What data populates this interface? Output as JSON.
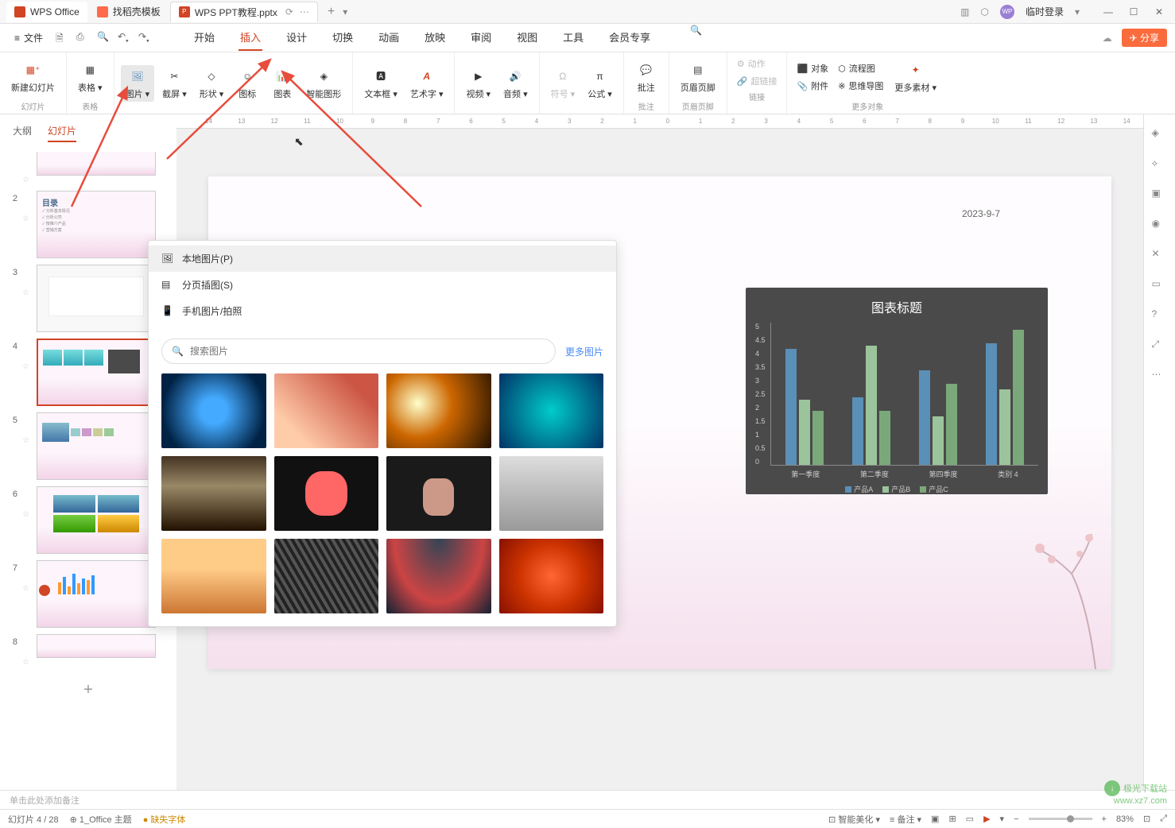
{
  "titlebar": {
    "wps_tab": "WPS Office",
    "template_tab": "找稻壳模板",
    "active_tab": "WPS PPT教程.pptx",
    "add_tab": "+",
    "login": "临时登录"
  },
  "menubar": {
    "file": "文件",
    "tabs": [
      "开始",
      "插入",
      "设计",
      "切换",
      "动画",
      "放映",
      "审阅",
      "视图",
      "工具",
      "会员专享"
    ],
    "active_tab_index": 1,
    "share": "分享"
  },
  "ribbon": {
    "groups": [
      {
        "label": "幻灯片",
        "buttons": [
          {
            "label": "新建幻灯片"
          }
        ]
      },
      {
        "label": "表格",
        "buttons": [
          {
            "label": "表格"
          }
        ]
      },
      {
        "label": "",
        "buttons": [
          {
            "label": "图片",
            "highlighted": true
          },
          {
            "label": "截屏"
          },
          {
            "label": "形状"
          },
          {
            "label": "图标"
          },
          {
            "label": "图表"
          },
          {
            "label": "智能图形"
          }
        ]
      },
      {
        "label": "",
        "buttons": [
          {
            "label": "文本框"
          },
          {
            "label": "艺术字"
          }
        ]
      },
      {
        "label": "",
        "buttons": [
          {
            "label": "视频"
          },
          {
            "label": "音频"
          }
        ]
      },
      {
        "label": "",
        "buttons": [
          {
            "label": "符号"
          },
          {
            "label": "公式"
          }
        ]
      },
      {
        "label": "批注",
        "buttons": [
          {
            "label": "批注"
          }
        ]
      },
      {
        "label": "页眉页脚",
        "buttons": [
          {
            "label": "页眉页脚"
          }
        ]
      },
      {
        "label": "链接",
        "small": [
          {
            "label": "动作",
            "disabled": true
          },
          {
            "label": "超链接",
            "disabled": true
          }
        ]
      },
      {
        "label": "更多对象",
        "buttons": [
          {
            "label": "对象"
          },
          {
            "label": "附件"
          }
        ],
        "small": [
          {
            "label": "流程图"
          },
          {
            "label": "思维导图"
          },
          {
            "label": "更多素材"
          }
        ]
      }
    ]
  },
  "left_panel": {
    "tabs": [
      "大纲",
      "幻灯片"
    ],
    "active_tab_index": 1,
    "slides": [
      {
        "num": ""
      },
      {
        "num": "2",
        "title": "目录"
      },
      {
        "num": "3"
      },
      {
        "num": "4",
        "selected": true
      },
      {
        "num": "5"
      },
      {
        "num": "6"
      },
      {
        "num": "7"
      },
      {
        "num": "8"
      }
    ]
  },
  "image_panel": {
    "items": [
      {
        "label": "本地图片(P)",
        "hover": true
      },
      {
        "label": "分页插图(S)"
      },
      {
        "label": "手机图片/拍照"
      }
    ],
    "search_placeholder": "搜索图片",
    "more": "更多图片",
    "thumbs": [
      "ai-chip",
      "dna",
      "welding",
      "bacteria",
      "cat",
      "flamingo",
      "thinking-man",
      "woman-dumbbell",
      "surfer",
      "architecture",
      "pole-vault",
      "autumn-leaves"
    ]
  },
  "slide": {
    "date": "2023-9-7"
  },
  "chart_data": {
    "type": "bar",
    "title": "图表标题",
    "categories": [
      "第一季度",
      "第二季度",
      "第四季度",
      "类别 4"
    ],
    "series": [
      {
        "name": "产品A",
        "color": "#5a8fb8",
        "values": [
          4.3,
          2.5,
          3.5,
          4.5
        ]
      },
      {
        "name": "产品B",
        "color": "#9cc49c",
        "values": [
          2.4,
          4.4,
          1.8,
          2.8
        ]
      },
      {
        "name": "产品C",
        "color": "#7aa87a",
        "values": [
          2.0,
          2.0,
          3.0,
          5.0
        ]
      }
    ],
    "ylim": [
      0,
      5
    ],
    "yticks": [
      0,
      0.5,
      1,
      1.5,
      2,
      2.5,
      3,
      3.5,
      4,
      4.5,
      5
    ]
  },
  "notes": {
    "placeholder": "单击此处添加备注"
  },
  "statusbar": {
    "slide_info": "幻灯片 4 / 28",
    "theme": "1_Office 主题",
    "missing_font": "缺失字体",
    "beautify": "智能美化",
    "notes": "备注",
    "zoom": "83%",
    "menu_icon": "☰"
  },
  "watermark": {
    "brand": "极光下载站",
    "url": "www.xz7.com"
  },
  "ruler_ticks": [
    "14",
    "13",
    "12",
    "11",
    "10",
    "9",
    "8",
    "7",
    "6",
    "5",
    "4",
    "3",
    "2",
    "1",
    "0",
    "1",
    "2",
    "3",
    "4",
    "5",
    "6",
    "7",
    "8",
    "9",
    "10",
    "11",
    "12",
    "13",
    "14"
  ]
}
